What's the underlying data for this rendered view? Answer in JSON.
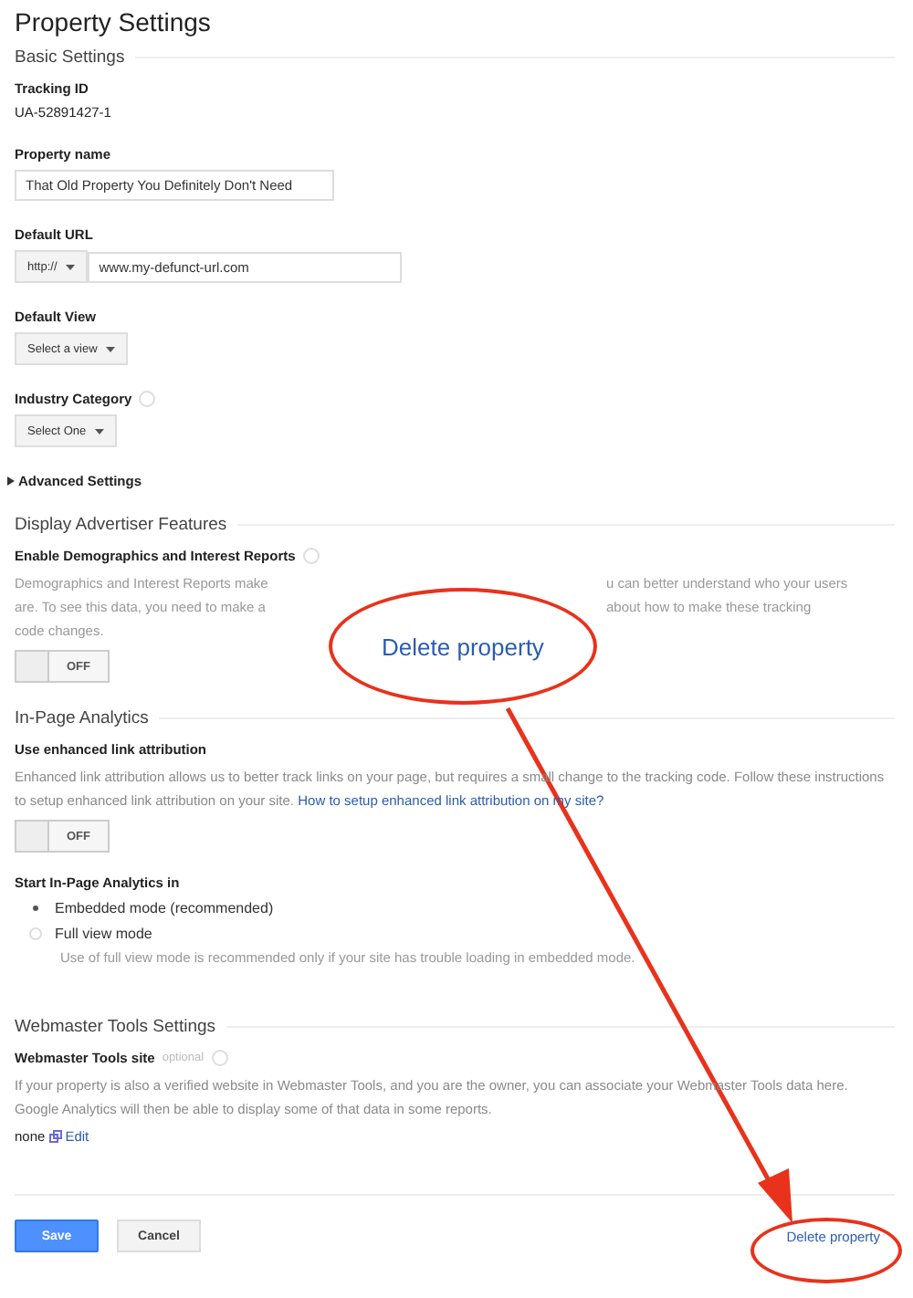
{
  "title": "Property Settings",
  "basic": {
    "heading": "Basic Settings",
    "tracking_label": "Tracking ID",
    "tracking_id": "UA-52891427-1",
    "name_label": "Property name",
    "name_value": "That Old Property You Definitely Don't Need",
    "url_label": "Default URL",
    "protocol": "http://",
    "url_value": "www.my-defunct-url.com",
    "view_label": "Default View",
    "view_select": "Select a view",
    "industry_label": "Industry Category",
    "industry_select": "Select One"
  },
  "advanced": {
    "label": "Advanced Settings",
    "expanded": false
  },
  "display": {
    "heading": "Display Advertiser Features",
    "setting_label": "Enable Demographics and Interest Reports",
    "description_lines": [
      {
        "left": "Demographics and Interest Reports make",
        "right": "u can better understand who your users"
      },
      {
        "left": "are. To see this data, you need to make a",
        "right": "about how to make these tracking"
      },
      {
        "left": "code changes."
      }
    ],
    "toggle": {
      "label": "OFF",
      "on": false
    }
  },
  "inpage": {
    "heading": "In-Page Analytics",
    "setting_label": "Use enhanced link attribution",
    "description": "Enhanced link attribution allows us to better track links on your page, but requires a small change to the tracking code. Follow these instructions to setup enhanced link attribution on your site.",
    "link": "How to setup enhanced link attribution on my site?",
    "toggle": {
      "label": "OFF",
      "on": false
    },
    "mode_label": "Start In-Page Analytics in",
    "modes": [
      {
        "label": "Embedded mode (recommended)",
        "selected": true
      },
      {
        "label": "Full view mode",
        "selected": false
      }
    ],
    "mode_note": "Use of full view mode is recommended only if your site has trouble loading in embedded mode."
  },
  "webmaster": {
    "heading": "Webmaster Tools Settings",
    "setting_label": "Webmaster Tools site",
    "optional": "optional",
    "description": "If your property is also a verified website in Webmaster Tools, and you are the owner, you can associate your Webmaster Tools data here. Google Analytics will then be able to display some of that data in some reports.",
    "value": "none",
    "edit": "Edit"
  },
  "buttons": {
    "save": "Save",
    "cancel": "Cancel",
    "delete": "Delete property"
  },
  "callout": {
    "text": "Delete property"
  }
}
